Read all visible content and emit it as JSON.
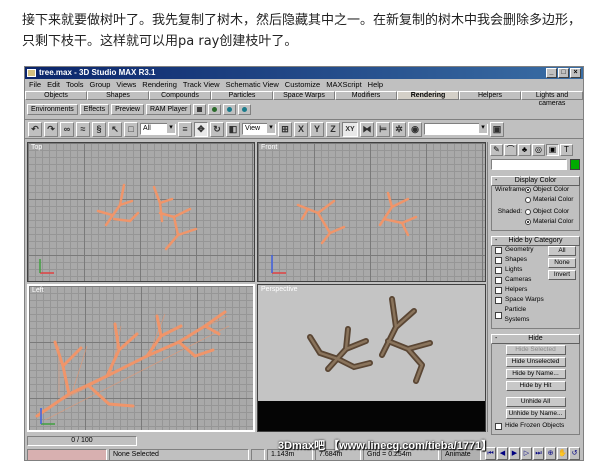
{
  "intro_text": "接下来就要做树叶了。我先复制了树木，然后隐藏其中之一。在新复制的树木中我会删除多边形，只剩下枝干。这样就可以用pa ray创建枝叶了。",
  "window": {
    "title": "tree.max - 3D Studio MAX R3.1",
    "controls": [
      "_",
      "□",
      "×"
    ]
  },
  "menu": [
    "File",
    "Edit",
    "Tools",
    "Group",
    "Views",
    "Rendering",
    "Track View",
    "Schematic View",
    "Customize",
    "MAXScript",
    "Help"
  ],
  "tabs": [
    {
      "label": "Objects"
    },
    {
      "label": "Shapes"
    },
    {
      "label": "Compounds"
    },
    {
      "label": "Particles"
    },
    {
      "label": "Space Warps"
    },
    {
      "label": "Modifiers"
    },
    {
      "label": "Rendering",
      "active": true
    },
    {
      "label": "Helpers"
    },
    {
      "label": "Lights and cameras"
    }
  ],
  "render_toolbar": [
    "Environments",
    "Effects",
    "Preview",
    "RAM Player"
  ],
  "main_toolbar": {
    "selection_filter": "All",
    "reference_coord": "View",
    "axis_buttons": [
      "X",
      "Y",
      "Z",
      "XY"
    ],
    "named_selection": ""
  },
  "viewports": {
    "top": "Top",
    "front": "Front",
    "left": "Left",
    "perspective": "Perspective"
  },
  "command_panel": {
    "object_color": "#00aa00",
    "display_color": {
      "title": "Display Color",
      "wireframe_label": "Wireframe:",
      "shaded_label": "Shaded:",
      "object_color": "Object Color",
      "material_color": "Material Color"
    },
    "hide_by_category": {
      "title": "Hide by Category",
      "items": [
        "Geometry",
        "Shapes",
        "Lights",
        "Cameras",
        "Helpers",
        "Space Warps",
        "Particle Systems"
      ],
      "buttons": [
        "All",
        "None",
        "Invert"
      ]
    },
    "hide": {
      "title": "Hide",
      "buttons": [
        "Hide Selected",
        "Hide Unselected",
        "Hide by Name...",
        "Hide by Hit",
        "Unhide All",
        "Unhide by Name..."
      ],
      "checkbox": "Hide Frozen Objects"
    }
  },
  "status_bar": {
    "time_slider": "0 / 100",
    "selection": "None Selected",
    "x": "1.143m",
    "y": "7.684m",
    "grid": "Grid = 0.254m",
    "animate": "Animate"
  },
  "watermark": "3Dmax吧 【www.linecg.com/tieba/1771】"
}
